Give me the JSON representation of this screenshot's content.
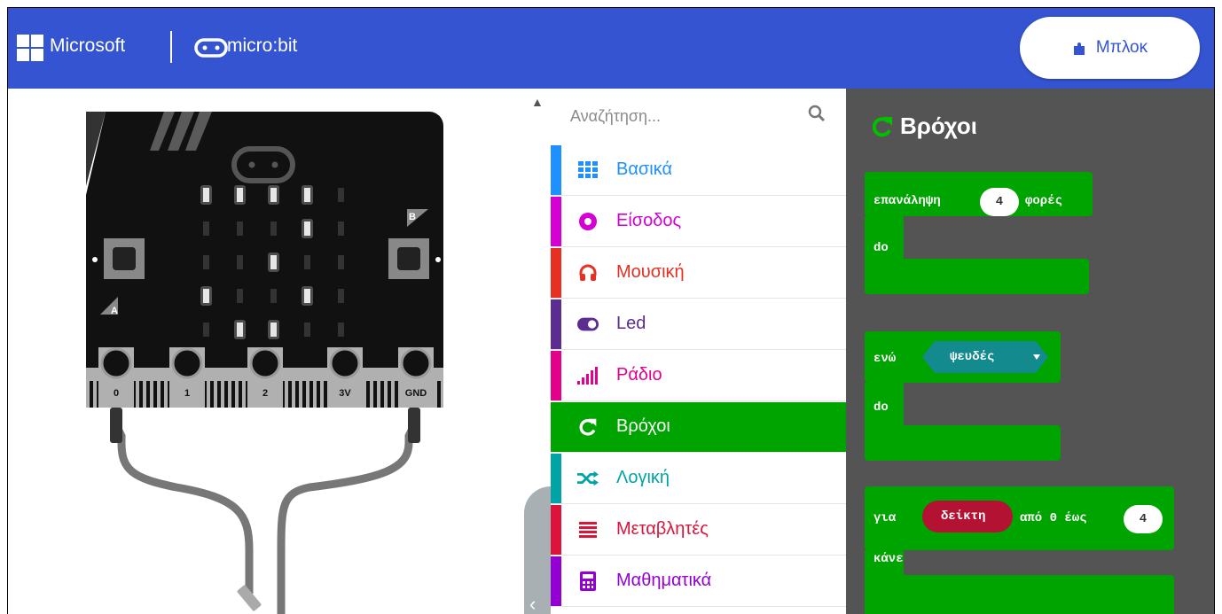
{
  "header": {
    "brand": "Microsoft",
    "product": "micro:bit",
    "blocks_button": "Μπλοκ",
    "color": "#3454d1"
  },
  "simulator": {
    "pins": [
      "0",
      "1",
      "2",
      "3V",
      "GND"
    ],
    "button_a": "A",
    "button_b": "B",
    "led_grid": [
      [
        1,
        1,
        1,
        1,
        0
      ],
      [
        0,
        0,
        0,
        1,
        0
      ],
      [
        0,
        0,
        1,
        0,
        0
      ],
      [
        1,
        0,
        0,
        1,
        0
      ],
      [
        0,
        1,
        1,
        0,
        0
      ]
    ]
  },
  "toolbox": {
    "search_placeholder": "Αναζήτηση...",
    "categories": [
      {
        "label": "Βασικά",
        "color": "#1e90ff",
        "icon": "grid-icon"
      },
      {
        "label": "Είσοδος",
        "color": "#d400d4",
        "icon": "input-icon"
      },
      {
        "label": "Μουσική",
        "color": "#e63022",
        "icon": "headphones-icon"
      },
      {
        "label": "Led",
        "color": "#5c2d91",
        "icon": "toggle-icon"
      },
      {
        "label": "Ράδιο",
        "color": "#e3008c",
        "icon": "signal-icon"
      },
      {
        "label": "Βρόχοι",
        "color": "#00a400",
        "icon": "loop-icon"
      },
      {
        "label": "Λογική",
        "color": "#00a4a6",
        "icon": "shuffle-icon"
      },
      {
        "label": "Μεταβλητές",
        "color": "#dc143c",
        "icon": "list-icon"
      },
      {
        "label": "Μαθηματικά",
        "color": "#9400d3",
        "icon": "calculator-icon"
      }
    ]
  },
  "flyout": {
    "title": "Βρόχοι",
    "repeat": {
      "prefix": "επανάληψη",
      "count": "4",
      "suffix": "φορές",
      "do": "do"
    },
    "while": {
      "prefix": "ενώ",
      "cond": "ψευδές",
      "do": "do"
    },
    "for": {
      "prefix": "για",
      "var": "δείκτη",
      "middle": "από 0 έως",
      "to": "4",
      "do": "κάνε"
    }
  }
}
